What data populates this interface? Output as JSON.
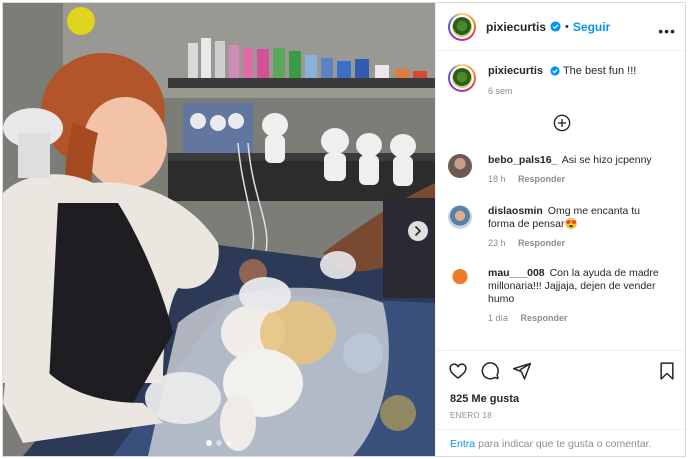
{
  "post": {
    "dots_count": 3,
    "active_dot": 1
  },
  "header": {
    "username": "pixiecurtis",
    "separator": "•",
    "follow_label": "Seguir",
    "more_label": "•••"
  },
  "caption": {
    "username": "pixiecurtis",
    "text": "The best fun !!!",
    "time": "6 sem"
  },
  "comments": [
    {
      "username": "bebo_pals16_",
      "text": "Asi se hizo jcpenny",
      "time": "18 h",
      "reply_label": "Responder"
    },
    {
      "username": "dislaosmin",
      "text": "Omg me encanta tu forma de pensar😍",
      "time": "23 h",
      "reply_label": "Responder"
    },
    {
      "username": "mau___008",
      "text": "Con la ayuda de madre millonaria!!! Jajjaja, dejen de vender humo",
      "time": "1 día",
      "reply_label": "Responder"
    }
  ],
  "footer": {
    "likes": "825 Me gusta",
    "date": "ENERO 18",
    "login_link": "Entra",
    "login_text": "para indicar que te gusta o comentar."
  },
  "icons": {
    "verified": "verified-badge-icon",
    "like": "heart-icon",
    "comment": "comment-icon",
    "share": "share-icon",
    "save": "bookmark-icon",
    "add": "plus-circle-icon",
    "next": "chevron-right-icon"
  },
  "colors": {
    "accent": "#0095f6",
    "text": "#262626",
    "muted": "#8e8e8e",
    "border": "#dbdbdb"
  }
}
